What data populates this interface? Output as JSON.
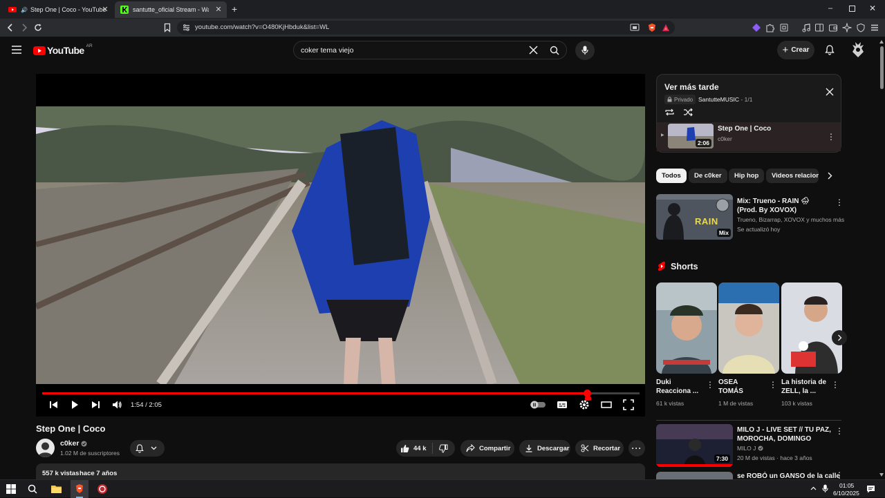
{
  "browser": {
    "tabs": [
      {
        "title": "Step One | Coco - YouTube",
        "active": true
      },
      {
        "title": "santutte_oficial Stream - Watch",
        "active": false
      }
    ],
    "url": "youtube.com/watch?v=O480KjHbduk&list=WL"
  },
  "header": {
    "logo": "YouTube",
    "region": "AR",
    "search_value": "coker tema viejo",
    "create_label": "Crear"
  },
  "player": {
    "time": "1:54 / 2:05",
    "progress": 0.912
  },
  "video": {
    "title": "Step One | Coco",
    "channel": "c0ker",
    "subscribers": "1.02 M de suscriptores",
    "likes": "44 k",
    "share_label": "Compartir",
    "download_label": "Descargar",
    "clip_label": "Recortar",
    "views": "557 k vistas",
    "age": "hace 7 años"
  },
  "playlist": {
    "title": "Ver más tarde",
    "privacy": "Privado",
    "owner": "SantutteMUSIC",
    "position": "1/1",
    "item": {
      "title": "Step One | Coco",
      "channel": "c0ker",
      "duration": "2:06"
    }
  },
  "chips": [
    "Todos",
    "De c0ker",
    "Hip hop",
    "Videos relacion"
  ],
  "recommendations": [
    {
      "title": "Mix: Trueno - RAIN 🌧 (Prod. By XOVOX)",
      "line1": "Trueno, Bizarrap, XOVOX y muchos más",
      "line2": "Se actualizó hoy",
      "badge": "Mix"
    },
    {
      "title": "MILO J - LIVE SET // TU PAZ, MOROCHA, DOMINGO",
      "line1": "MILO J",
      "line2": "20 M de vistas · hace 3 años",
      "duration": "7:30"
    },
    {
      "title": "se ROBÓ un GANSO de la calle v"
    }
  ],
  "shorts": {
    "heading": "Shorts",
    "items": [
      {
        "title": "Duki Reacciona ...",
        "views": "61 k vistas"
      },
      {
        "title": "OSEA TOMÁS",
        "views": "1 M de vistas"
      },
      {
        "title": "La historia de ZELL, la ...",
        "views": "103 k vistas"
      }
    ]
  },
  "thumb_text": {
    "rain": "RAIN"
  },
  "taskbar": {
    "time": "01:05",
    "date": "6/10/2025"
  },
  "colors": {
    "accent": "#ff0000",
    "bg": "#0f0f0f"
  }
}
